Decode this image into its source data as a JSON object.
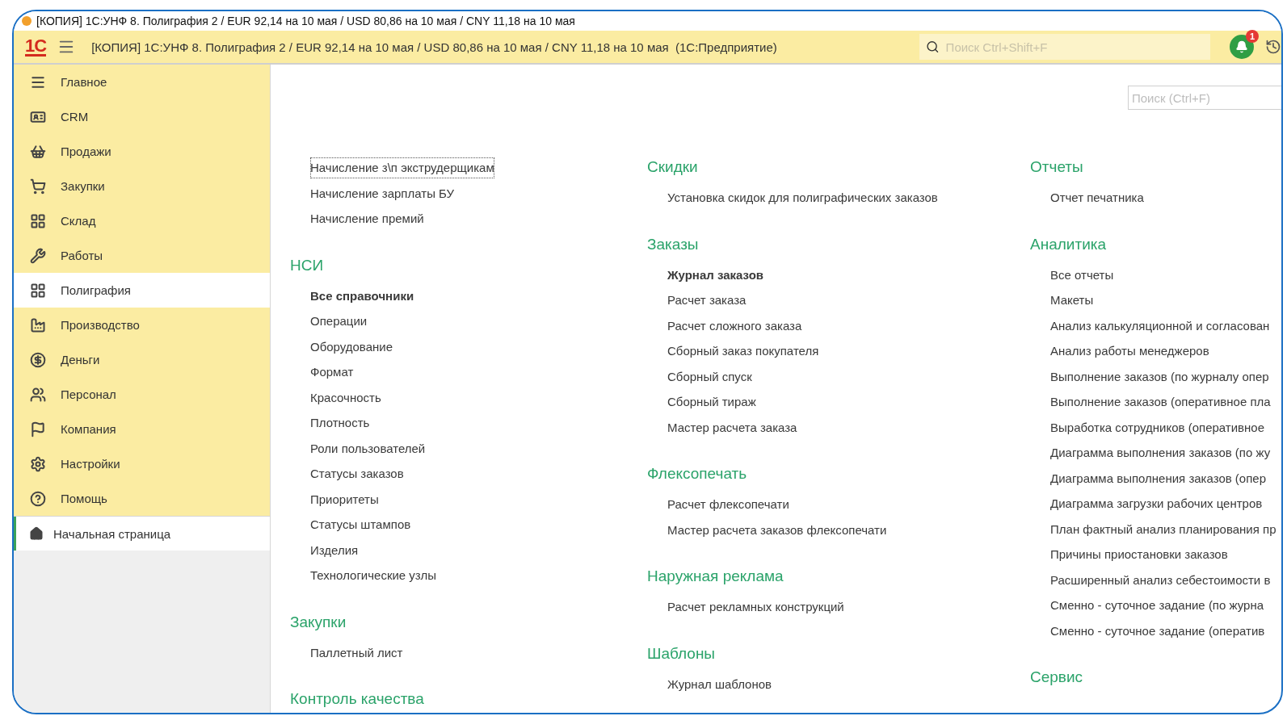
{
  "window": {
    "title": "[КОПИЯ] 1С:УНФ 8. Полиграфия 2 / EUR 92,14 на 10 мая / USD 80,86 на 10 мая / CNY 11,18 на 10 мая"
  },
  "app_bar": {
    "logo": "1С",
    "title": "[КОПИЯ] 1С:УНФ 8. Полиграфия 2 / EUR 92,14 на 10 мая / USD 80,86 на 10 мая / CNY 11,18 на 10 мая  (1С:Предприятие)",
    "search": {
      "placeholder": "Поиск Ctrl+Shift+F"
    },
    "notifications": {
      "count": "1"
    }
  },
  "sidebar": {
    "items": [
      {
        "label": "Главное",
        "selected": false
      },
      {
        "label": "CRM",
        "selected": false
      },
      {
        "label": "Продажи",
        "selected": false
      },
      {
        "label": "Закупки",
        "selected": false
      },
      {
        "label": "Склад",
        "selected": false
      },
      {
        "label": "Работы",
        "selected": false
      },
      {
        "label": "Полиграфия",
        "selected": true
      },
      {
        "label": "Производство",
        "selected": false
      },
      {
        "label": "Деньги",
        "selected": false
      },
      {
        "label": "Персонал",
        "selected": false
      },
      {
        "label": "Компания",
        "selected": false
      },
      {
        "label": "Настройки",
        "selected": false
      },
      {
        "label": "Помощь",
        "selected": false
      }
    ],
    "open_windows": [
      {
        "label": "Начальная страница",
        "selected": true
      }
    ]
  },
  "content": {
    "search": {
      "placeholder": "Поиск (Ctrl+F)"
    },
    "columns": [
      {
        "groups": [
          {
            "items": [
              {
                "label": "Начисление з\\п экструдерщикам",
                "bold": false,
                "focused": true
              },
              {
                "label": "Начисление зарплаты БУ",
                "bold": false,
                "focused": false
              },
              {
                "label": "Начисление премий",
                "bold": false,
                "focused": false
              }
            ]
          },
          {
            "heading": "НСИ",
            "items": [
              {
                "label": "Все справочники",
                "bold": true
              },
              {
                "label": "Операции",
                "bold": false
              },
              {
                "label": "Оборудование",
                "bold": false
              },
              {
                "label": "Формат",
                "bold": false
              },
              {
                "label": "Красочность",
                "bold": false
              },
              {
                "label": "Плотность",
                "bold": false
              },
              {
                "label": "Роли пользователей",
                "bold": false
              },
              {
                "label": "Статусы заказов",
                "bold": false
              },
              {
                "label": "Приоритеты",
                "bold": false
              },
              {
                "label": "Статусы штампов",
                "bold": false
              },
              {
                "label": "Изделия",
                "bold": false
              },
              {
                "label": "Технологические узлы",
                "bold": false
              }
            ]
          },
          {
            "heading": "Закупки",
            "items": [
              {
                "label": "Паллетный лист",
                "bold": false
              }
            ]
          },
          {
            "heading": "Контроль качества"
          }
        ]
      },
      {
        "groups": [
          {
            "heading": "Скидки",
            "items": [
              {
                "label": "Установка скидок для полиграфических заказов",
                "bold": false
              }
            ]
          },
          {
            "heading": "Заказы",
            "items": [
              {
                "label": "Журнал заказов",
                "bold": true
              },
              {
                "label": "Расчет заказа",
                "bold": false
              },
              {
                "label": "Расчет сложного заказа",
                "bold": false
              },
              {
                "label": "Сборный заказ покупателя",
                "bold": false
              },
              {
                "label": "Сборный спуск",
                "bold": false
              },
              {
                "label": "Сборный тираж",
                "bold": false
              },
              {
                "label": "Мастер расчета заказа",
                "bold": false
              }
            ]
          },
          {
            "heading": "Флексопечать",
            "items": [
              {
                "label": "Расчет флексопечати",
                "bold": false
              },
              {
                "label": "Мастер расчета заказов флексопечати",
                "bold": false
              }
            ]
          },
          {
            "heading": "Наружная реклама",
            "items": [
              {
                "label": "Расчет рекламных конструкций",
                "bold": false
              }
            ]
          },
          {
            "heading": "Шаблоны",
            "items": [
              {
                "label": "Журнал шаблонов",
                "bold": false
              }
            ]
          }
        ]
      },
      {
        "groups": [
          {
            "heading": "Отчеты",
            "items": [
              {
                "label": "Отчет печатника",
                "bold": false
              }
            ]
          },
          {
            "heading": "Аналитика",
            "items": [
              {
                "label": "Все отчеты",
                "bold": false
              },
              {
                "label": "Макеты",
                "bold": false
              },
              {
                "label": "Анализ калькуляционной и согласован",
                "bold": false
              },
              {
                "label": "Анализ работы менеджеров",
                "bold": false
              },
              {
                "label": "Выполнение заказов (по журналу опер",
                "bold": false
              },
              {
                "label": "Выполнение заказов (оперативное пла",
                "bold": false
              },
              {
                "label": "Выработка сотрудников (оперативное",
                "bold": false
              },
              {
                "label": "Диаграмма выполнения заказов (по жу",
                "bold": false
              },
              {
                "label": "Диаграмма выполнения заказов (опер",
                "bold": false
              },
              {
                "label": "Диаграмма загрузки рабочих центров",
                "bold": false
              },
              {
                "label": "План фактный анализ планирования пр",
                "bold": false
              },
              {
                "label": "Причины приостановки заказов",
                "bold": false
              },
              {
                "label": "Расширенный анализ себестоимости в",
                "bold": false
              },
              {
                "label": "Сменно - суточное задание (по журна",
                "bold": false
              },
              {
                "label": "Сменно - суточное задание  (оператив",
                "bold": false
              }
            ]
          },
          {
            "heading": "Сервис"
          }
        ]
      }
    ]
  }
}
